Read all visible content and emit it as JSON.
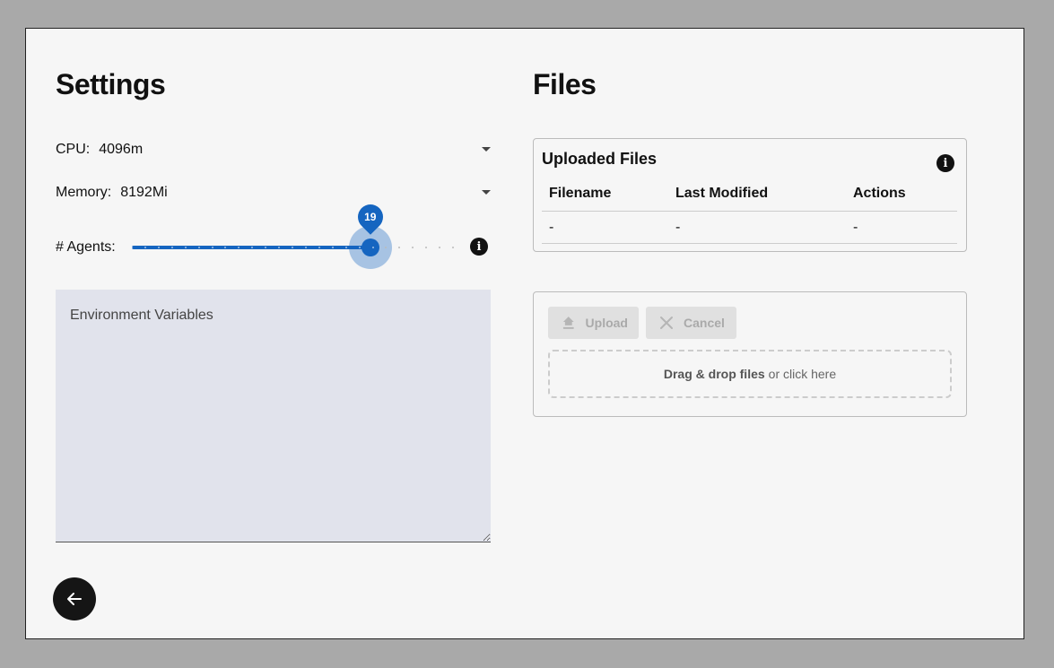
{
  "settings": {
    "title": "Settings",
    "cpu": {
      "label": "CPU:",
      "value": "4096m"
    },
    "memory": {
      "label": "Memory:",
      "value": "8192Mi"
    },
    "agents": {
      "label": "# Agents:",
      "value": 19,
      "value_label": "19",
      "min": 1,
      "max": 25
    },
    "env": {
      "placeholder": "Environment Variables",
      "value": ""
    }
  },
  "files": {
    "title": "Files",
    "uploaded": {
      "title": "Uploaded Files",
      "columns": [
        "Filename",
        "Last Modified",
        "Actions"
      ],
      "rows": [
        [
          "-",
          "-",
          "-"
        ]
      ]
    },
    "upload": {
      "upload_label": "Upload",
      "cancel_label": "Cancel",
      "drop_bold": "Drag & drop files",
      "drop_rest": "or click here"
    }
  },
  "icons": {
    "info": "info-icon",
    "back": "arrow-left-icon",
    "upload": "upload-icon",
    "cancel": "close-icon",
    "dropdown": "caret-down-icon"
  },
  "colors": {
    "accent": "#1565c0",
    "field_bg": "#e1e3ec",
    "surface": "#f6f6f6"
  }
}
